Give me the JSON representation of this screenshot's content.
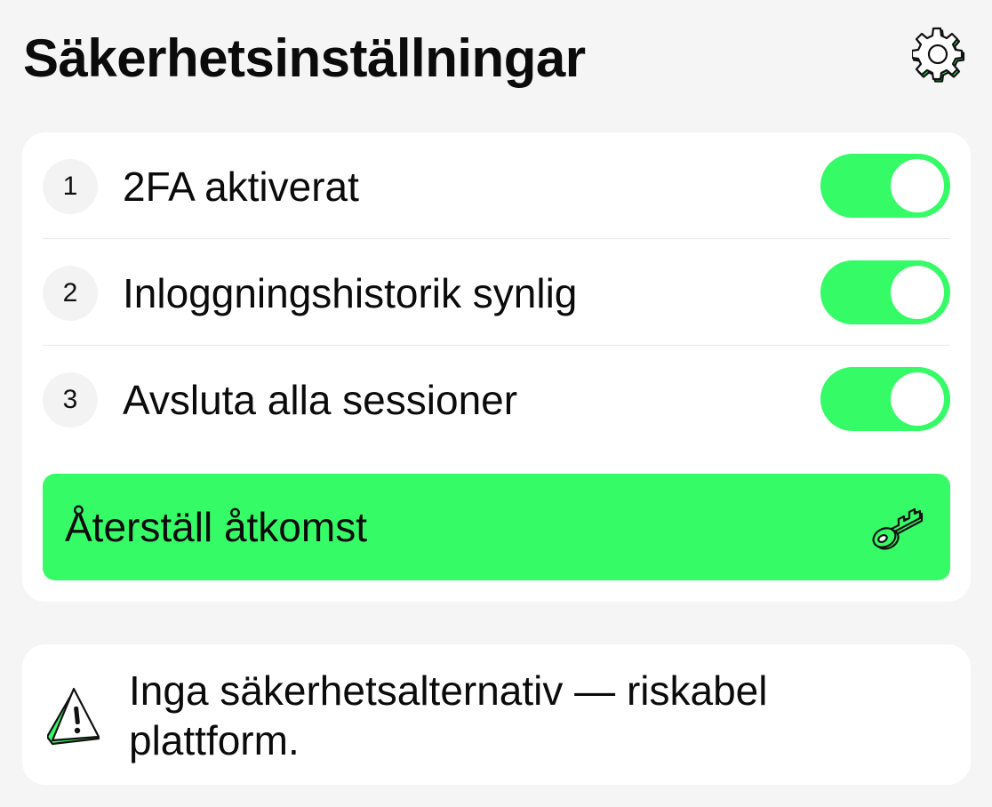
{
  "header": {
    "title": "Säkerhetsinställningar",
    "settings_icon": "gear-icon"
  },
  "settings": {
    "items": [
      {
        "number": "1",
        "label": "2FA aktiverat",
        "enabled": true
      },
      {
        "number": "2",
        "label": "Inloggningshistorik synlig",
        "enabled": true
      },
      {
        "number": "3",
        "label": "Avsluta alla sessioner",
        "enabled": true
      }
    ],
    "reset_button": {
      "label": "Återställ åtkomst",
      "icon": "key-icon"
    }
  },
  "notice": {
    "text": "Inga säkerhetsalternativ — riskabel plattform.",
    "icon": "warning-icon"
  },
  "colors": {
    "accent": "#35fb67",
    "background": "#f5f5f5",
    "card": "#ffffff",
    "text": "#0b0b0b"
  }
}
